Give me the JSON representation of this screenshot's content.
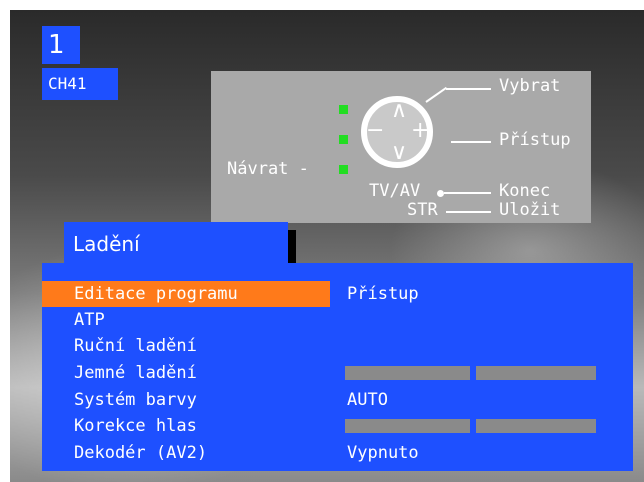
{
  "channel": {
    "number": "1",
    "name": "CH41"
  },
  "help": {
    "select": "Vybrat",
    "access": "Přístup",
    "back": "Návrat -",
    "tv_av": "TV/AV",
    "end": "Konec",
    "str": "STR",
    "save": "Uložit",
    "up": "∧",
    "down": "∨",
    "minus": "−",
    "plus": "+"
  },
  "menu": {
    "title": "Ladění",
    "items": [
      {
        "label": "Editace programu",
        "value": "Přístup"
      },
      {
        "label": "ATP",
        "value": ""
      },
      {
        "label": "Ruční ladění",
        "value": ""
      },
      {
        "label": "Jemné ladění",
        "value": ""
      },
      {
        "label": "Systém barvy",
        "value": "AUTO"
      },
      {
        "label": "Korekce hlas",
        "value": ""
      },
      {
        "label": "Dekodér (AV2)",
        "value": "Vypnuto"
      }
    ],
    "selected_index": 0
  },
  "colors": {
    "osd_blue": "#1e50ff",
    "highlight": "#ff7a1a",
    "help_bg": "#a9a9a9",
    "indicator": "#22dd22"
  }
}
